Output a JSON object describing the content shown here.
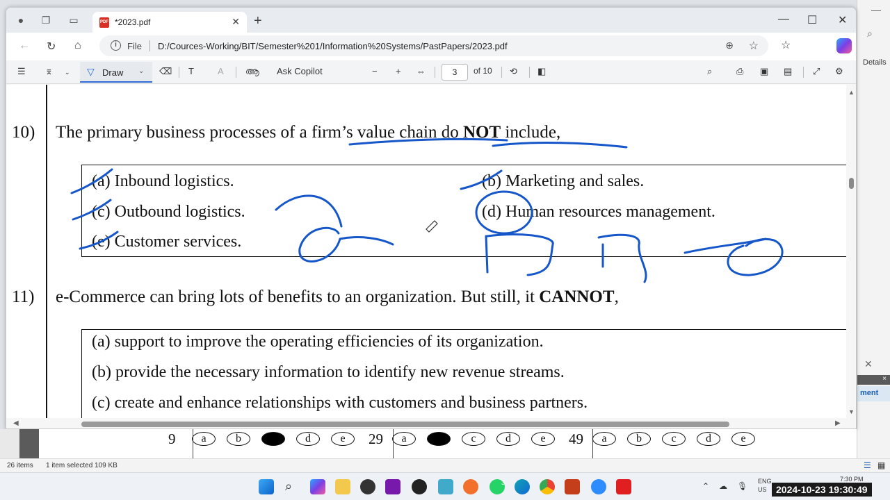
{
  "browser": {
    "tab_title": "*2023.pdf",
    "file_label": "File",
    "url": "D:/Cources-Working/BIT/Semester%201/Information%20Systems/PastPapers/2023.pdf"
  },
  "pdf_toolbar": {
    "draw_label": "Draw",
    "ask_copilot_label": "Ask Copilot",
    "current_page": "3",
    "page_total": "of 10"
  },
  "document": {
    "q10": {
      "number": "10)",
      "text_before": "The primary business processes of a firm’s value chain do ",
      "text_bold": "NOT",
      "text_after": " include,",
      "options": [
        {
          "letter": "(a)",
          "text": "Inbound logistics."
        },
        {
          "letter": "(b)",
          "text": "Marketing and sales."
        },
        {
          "letter": "(c)",
          "text": "Outbound logistics."
        },
        {
          "letter": "(d)",
          "text": "Human resources management."
        },
        {
          "letter": "(e)",
          "text": "Customer services."
        }
      ]
    },
    "q11": {
      "number": "11)",
      "text_before": "e-Commerce can bring lots of benefits to an organization. But still, it ",
      "text_bold": "CANNOT",
      "text_after": ",",
      "options": [
        {
          "letter": "(a)",
          "text": "support to improve the operating efficiencies of its organization."
        },
        {
          "letter": "(b)",
          "text": "provide the necessary information to identify new revenue streams."
        },
        {
          "letter": "(c)",
          "text": "create and enhance relationships with customers and business partners."
        }
      ]
    }
  },
  "answer_sheet": {
    "groups": [
      {
        "number": "9",
        "bubbles": [
          "a",
          "b",
          "",
          "d",
          "e"
        ]
      },
      {
        "number": "29",
        "bubbles": [
          "a",
          "",
          "c",
          "d",
          "e"
        ]
      },
      {
        "number": "49",
        "bubbles": [
          "a",
          "b",
          "c",
          "d",
          "e"
        ]
      }
    ]
  },
  "explorer_status": {
    "items": "26 items",
    "selected": "1 item selected  109 KB"
  },
  "side_panel": {
    "details_label": "Details",
    "button_label": "ment"
  },
  "taskbar": {
    "lang_line1": "ENG",
    "lang_line2": "US",
    "time": "7:30 PM",
    "clock_overlay": "2024-10-23 19:30:49",
    "badge_count": "3"
  },
  "colors": {
    "ink": "#1556c9",
    "accent": "#2d6bd6"
  }
}
